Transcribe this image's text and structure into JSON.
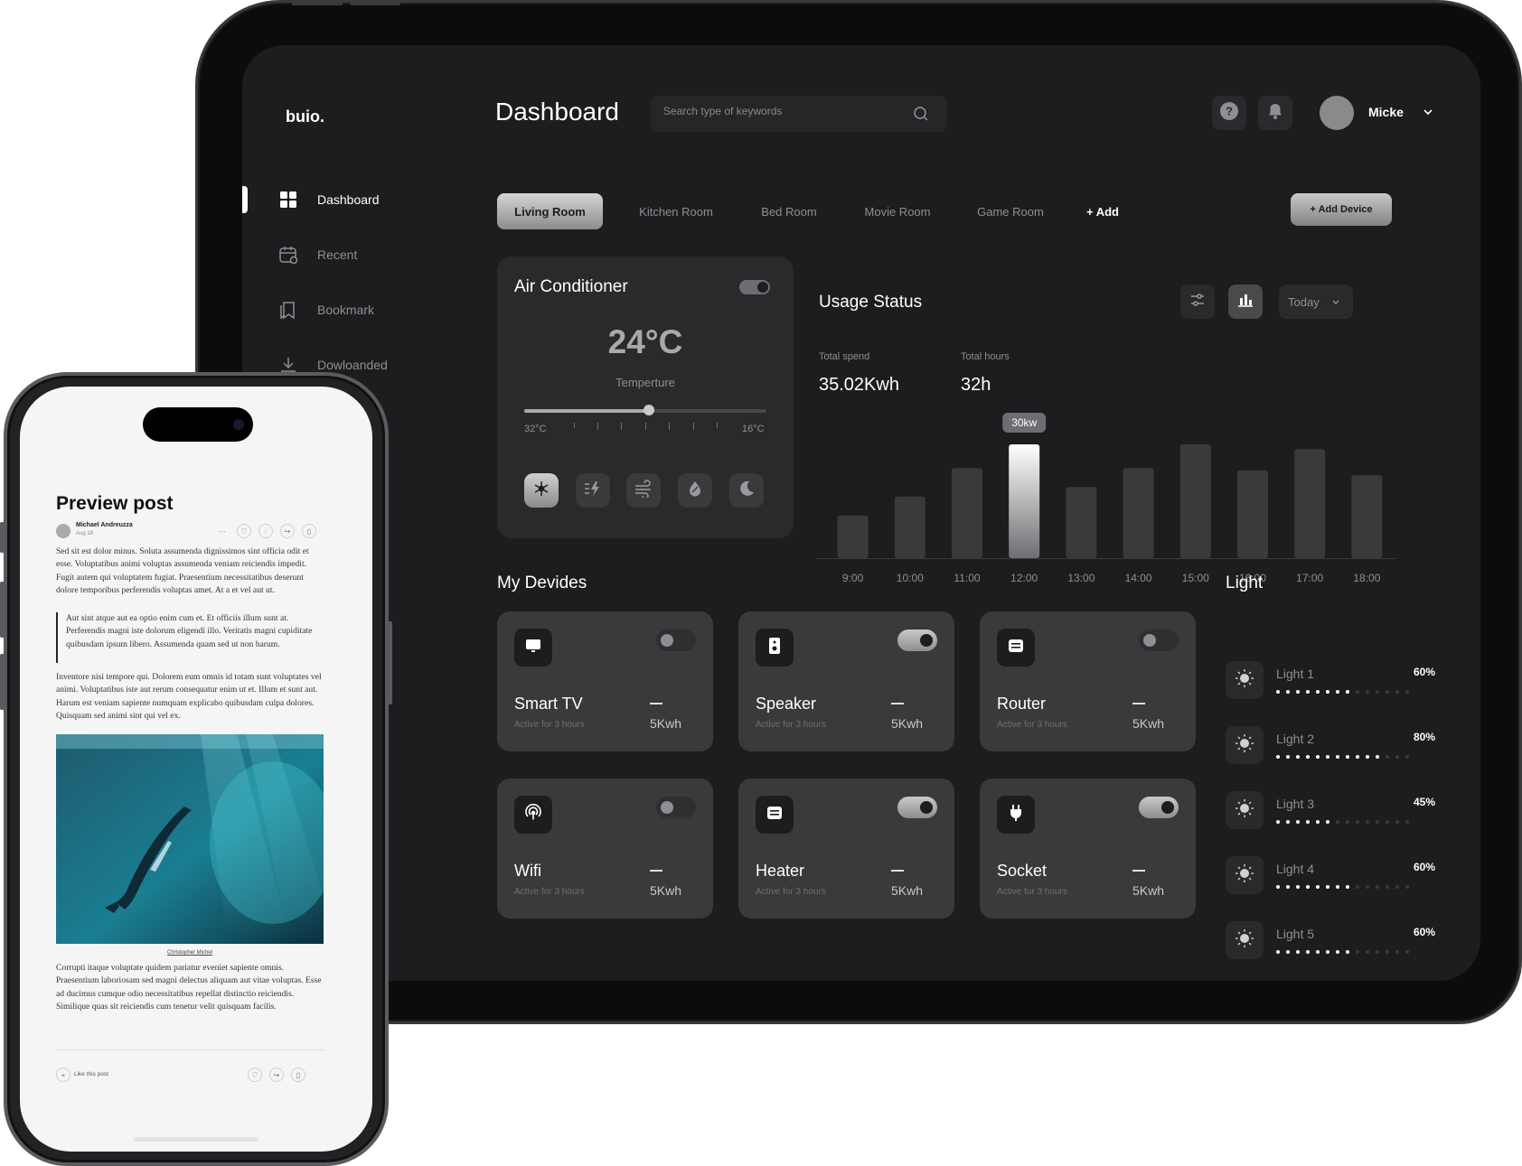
{
  "dashboard": {
    "logo": "buio.",
    "title": "Dashboard",
    "search": {
      "placeholder": "Search type of keywords"
    },
    "user": {
      "name": "Micke"
    },
    "nav": [
      {
        "label": "Dashboard",
        "icon": "grid-icon",
        "active": true
      },
      {
        "label": "Recent",
        "icon": "calendar-clock-icon",
        "active": false
      },
      {
        "label": "Bookmark",
        "icon": "bookmark-icon",
        "active": false
      },
      {
        "label": "Dowloanded",
        "icon": "download-icon",
        "active": false
      }
    ],
    "rooms": [
      {
        "label": "Living Room",
        "active": true
      },
      {
        "label": "Kitchen Room",
        "active": false
      },
      {
        "label": "Bed Room",
        "active": false
      },
      {
        "label": "Movie Room",
        "active": false
      },
      {
        "label": "Game Room",
        "active": false
      },
      {
        "label": "+ Add",
        "active": false
      }
    ],
    "add_device_label": "+ Add Device",
    "air_conditioner": {
      "title": "Air Conditioner",
      "on": true,
      "temperature": "24°C",
      "temperature_label": "Temperture",
      "slider_min_label": "32°C",
      "slider_max_label": "16°C",
      "slider_level": 0.5,
      "modes": [
        "snowflake-icon",
        "bolt-icon",
        "wind-icon",
        "drop-icon",
        "moon-icon"
      ]
    },
    "usage": {
      "title": "Usage Status",
      "total_spend_label": "Total spend",
      "total_spend_value": "35.02Kwh",
      "total_hours_label": "Total hours",
      "total_hours_value": "32h",
      "range": "Today"
    },
    "devices_title": "My Devides",
    "devices": [
      {
        "name": "Smart TV",
        "sub": "Active for 3 hours",
        "kwh": "5Kwh",
        "on": false,
        "icon": "tv-icon"
      },
      {
        "name": "Speaker",
        "sub": "Active for 3 hours",
        "kwh": "5Kwh",
        "on": true,
        "icon": "speaker-icon"
      },
      {
        "name": "Router",
        "sub": "Active for 3 hours",
        "kwh": "5Kwh",
        "on": false,
        "icon": "router-icon"
      },
      {
        "name": "Wifi",
        "sub": "Active for 3 hours",
        "kwh": "5Kwh",
        "on": false,
        "icon": "wifi-icon"
      },
      {
        "name": "Heater",
        "sub": "Active for 3 hours",
        "kwh": "5Kwh",
        "on": true,
        "icon": "heater-icon"
      },
      {
        "name": "Socket",
        "sub": "Active for 3 hours",
        "kwh": "5Kwh",
        "on": true,
        "icon": "plug-icon"
      }
    ],
    "light_title": "Light",
    "lights": [
      {
        "name": "Light 1",
        "pct": "60%",
        "level": 0.6
      },
      {
        "name": "Light 2",
        "pct": "80%",
        "level": 0.8
      },
      {
        "name": "Light 3",
        "pct": "45%",
        "level": 0.45
      },
      {
        "name": "Light 4",
        "pct": "60%",
        "level": 0.6
      },
      {
        "name": "Light 5",
        "pct": "60%",
        "level": 0.6
      }
    ]
  },
  "chart_data": {
    "type": "bar",
    "categories": [
      "9:00",
      "10:00",
      "11:00",
      "12:00",
      "13:00",
      "14:00",
      "15:00",
      "16:00",
      "17:00",
      "18:00"
    ],
    "values": [
      9,
      13,
      19,
      24,
      15,
      19,
      24,
      18.5,
      23,
      17,
      30
    ],
    "bar_labels": [
      "",
      "",
      "",
      "",
      "",
      "",
      "",
      "",
      "",
      "",
      ""
    ],
    "highlight_index": 3,
    "highlight_label": "30kw",
    "ylim": [
      0,
      32
    ],
    "grid": false
  },
  "post": {
    "title": "Preview post",
    "author": "Michael Andreuzza",
    "date": "Aug 18",
    "para1": "Sed sit est dolor minus. Soluta assumenda dignissimos sint officia odit et esse. Voluptatibus animi voluptas assumenda veniam reiciendis impedit. Fugit autem qui voluptatem fugiat. Praesentium necessitatibus deserunt dolore temporibus perferendis voluptas amet. At a et vel aut ut.",
    "quote": "Aut sint atque aut ea optio enim cum et. Et officiis illum sunt at. Perferendis magni iste dolorum eligendi illo. Veritatis magni cupiditate quibusdam ipsum libero. Assumenda quam sed ut non harum.",
    "para2": "Inventore nisi tempore qui. Dolorem eum omnis id totam sunt voluptates vel animi. Voluptatibus iste aut rerum consequatur enim ut et. Illum et sunt aut. Harum est veniam sapiente numquam explicabo quibusdam culpa dolores. Quisquam sed animi sint qui vel ex.",
    "image_caption": "Christopher Michel",
    "para3": "Corrupti itaque voluptate quidem pariatur eveniet sapiente omnis. Praesentium laboriosam sed magni delectus aliquam aut vitae voluptas. Esse ad ducimus cumque odio necessitatibus repellat distinctio reiciendis. Similique quas sit reiciendis cum tenetur velit quisquam facilis.",
    "like_label": "Like this post"
  },
  "colors": {
    "screen_bg": "#1d1d1f",
    "card_bg": "#2a2a2c",
    "device_card_bg": "#3a3a3c",
    "accent_light": "#c9c9cb"
  }
}
